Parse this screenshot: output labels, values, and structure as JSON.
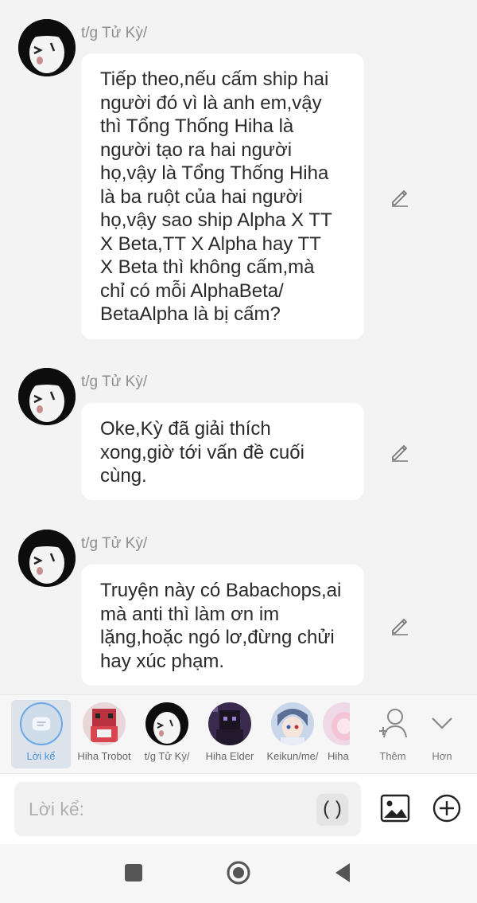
{
  "messages": [
    {
      "author": "t/g Tử Kỳ/",
      "text": "Tiếp theo,nếu cấm ship hai\nngười đó vì là anh em,vậy\nthì Tổng Thống Hiha là\nngười tạo ra hai người\nhọ,vậy là Tổng Thống Hiha\nlà ba ruột của hai người\nhọ,vậy sao ship Alpha X TT\nX Beta,TT X Alpha hay TT\nX Beta thì không cấm,mà\nchỉ có mỗi AlphaBeta/\nBetaAlpha là bị cấm?"
    },
    {
      "author": "t/g Tử Kỳ/",
      "text": "Oke,Kỳ đã giải thích\nxong,giờ tới vấn đề cuối\ncùng."
    },
    {
      "author": "t/g Tử Kỳ/",
      "text": "Truyện này có Babachops,ai\nmà anti thì làm ơn im\nlặng,hoặc ngó lơ,đừng chửi\nhay xúc phạm."
    }
  ],
  "characters": [
    {
      "name": "Lời kể",
      "selected": true
    },
    {
      "name": "Hiha Trobot"
    },
    {
      "name": "t/g Tử Kỳ/"
    },
    {
      "name": "Hiha Elder"
    },
    {
      "name": "Keikun/me/"
    },
    {
      "name": "Hiha"
    }
  ],
  "actions": {
    "add_label": "Thêm",
    "more_label": "Hơn"
  },
  "composer": {
    "placeholder": "Lời kể:",
    "paren_label": "()"
  },
  "colors": {
    "accent": "#4a90d9",
    "bubble": "#ffffff",
    "background": "#f3f3f3"
  },
  "icons": [
    "edit-icon",
    "narration-icon",
    "add-person-icon",
    "chevron-down-icon",
    "image-icon",
    "plus-circle-icon",
    "nav-square-icon",
    "nav-home-icon",
    "nav-back-icon"
  ]
}
